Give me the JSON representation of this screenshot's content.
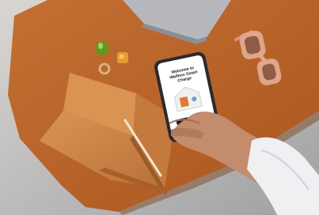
{
  "phone_screen": {
    "title_line1": "Welcome to",
    "title_line2": "Wallbox Smart Charge"
  },
  "colors": {
    "floor": "#c9c6c1",
    "desk": "#c0672a",
    "notebook": "#cf8a4b",
    "sunglasses": "#e0a58a",
    "phone_body": "#2a2a2e",
    "sleeve": "#eef0f2"
  }
}
